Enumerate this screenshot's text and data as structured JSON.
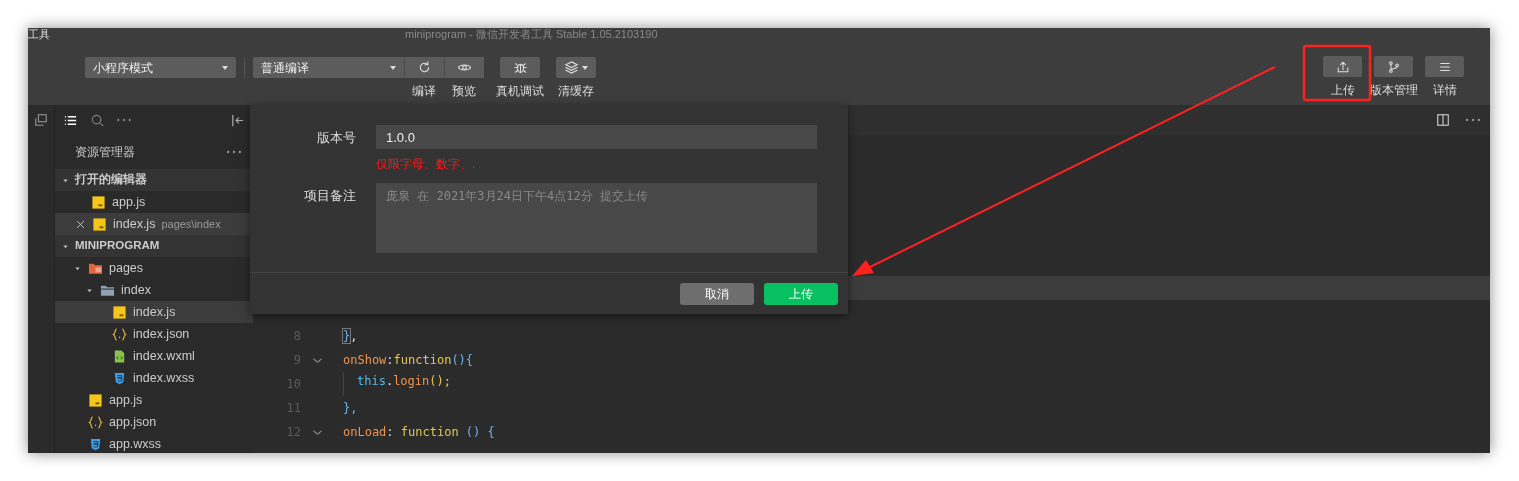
{
  "window": {
    "menu_item": "工具",
    "title": "miniprogram - 微信开发者工具 Stable 1.05.2103190"
  },
  "toolbar": {
    "left": [
      {
        "kind": "select",
        "value": "小程序模式"
      },
      {
        "kind": "divider"
      },
      {
        "kind": "select-group",
        "value": "普通编译"
      },
      {
        "kind": "group-tool",
        "label": "编译"
      },
      {
        "kind": "group-tool",
        "label": "预览"
      },
      {
        "kind": "tool",
        "label": "真机调试"
      },
      {
        "kind": "dropdown-tool",
        "label": "清缓存"
      }
    ],
    "right": [
      {
        "label": "上传"
      },
      {
        "label": "版本管理"
      },
      {
        "label": "详情"
      }
    ]
  },
  "sidebar": {
    "tabs": [
      {
        "selected": true
      },
      {
        "selected": false
      },
      {
        "selected": false
      }
    ],
    "title": "资源管理器",
    "sections": [
      {
        "title": "打开的编辑器",
        "expanded": true,
        "items": [
          {
            "name": "app.js",
            "kind": "js",
            "closable": false,
            "selected": false
          },
          {
            "name": "index.js",
            "kind": "js",
            "detail": "pages\\index",
            "closable": true,
            "selected": true
          }
        ]
      },
      {
        "title": "MINIPROGRAM",
        "expanded": true,
        "items": [
          {
            "name": "pages",
            "kind": "pages-folder",
            "expanded": true,
            "selected": false,
            "children": [
              {
                "name": "index",
                "kind": "folder",
                "expanded": true,
                "selected": false,
                "children": [
                  {
                    "name": "index.js",
                    "kind": "js",
                    "selected": true
                  },
                  {
                    "name": "index.json",
                    "kind": "json",
                    "selected": false
                  },
                  {
                    "name": "index.wxml",
                    "kind": "wxml",
                    "selected": false
                  },
                  {
                    "name": "index.wxss",
                    "kind": "wxss",
                    "selected": false
                  }
                ]
              }
            ]
          },
          {
            "name": "app.js",
            "kind": "js",
            "selected": false
          },
          {
            "name": "app.json",
            "kind": "json",
            "selected": false
          },
          {
            "name": "app.wxss",
            "kind": "wxss",
            "selected": false
          }
        ]
      }
    ]
  },
  "editor": {
    "lines": [
      {
        "highlighted": true
      },
      {
        "number": "8",
        "foldable": false,
        "highlighted": false,
        "tokens": [
          {
            "text": "}",
            "kind": "match"
          },
          {
            "text": ",",
            "kind": "punct"
          }
        ]
      },
      {
        "number": "9",
        "foldable": true,
        "highlighted": false,
        "tokens": [
          {
            "text": "onShow",
            "kind": "prop"
          },
          {
            "text": ":",
            "kind": "punct"
          },
          {
            "text": "function",
            "kind": "keyword"
          },
          {
            "text": "(){",
            "kind": "paren"
          }
        ],
        "children": [
          {
            "number": "10",
            "foldable": false,
            "highlighted": false,
            "tokens": [
              {
                "text": "this",
                "kind": "this"
              },
              {
                "text": ".",
                "kind": "punct"
              },
              {
                "text": "login",
                "kind": "prop"
              },
              {
                "text": "();",
                "kind": "keyword"
              }
            ]
          }
        ]
      },
      {
        "number": "11",
        "foldable": false,
        "highlighted": false,
        "tokens": [
          {
            "text": "},",
            "kind": "paren"
          }
        ]
      },
      {
        "number": "12",
        "foldable": true,
        "highlighted": false,
        "tokens": [
          {
            "text": "onLoad",
            "kind": "prop"
          },
          {
            "text": ": ",
            "kind": "punct"
          },
          {
            "text": "function",
            "kind": "keyword"
          },
          {
            "text": " () {",
            "kind": "paren"
          }
        ]
      }
    ]
  },
  "dialog": {
    "version_label": "版本号",
    "version_value": "1.0.0",
    "version_hint": "仅限字母、数字、.",
    "note_label": "项目备注",
    "note_placeholder": "庞泉 在 2021年3月24日下午4点12分 提交上传",
    "buttons": [
      {
        "label": "取消",
        "kind": "secondary"
      },
      {
        "label": "上传",
        "kind": "primary"
      }
    ]
  }
}
